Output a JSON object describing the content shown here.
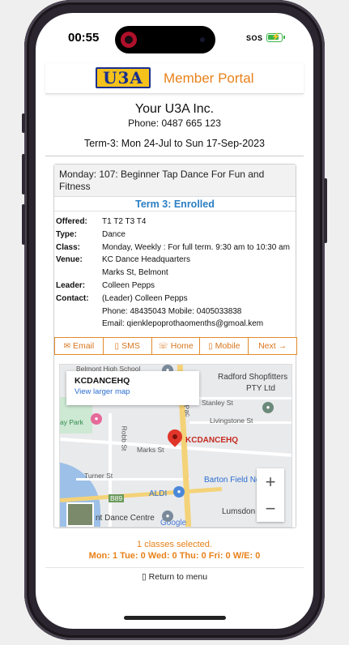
{
  "status": {
    "time": "00:55",
    "sos": "SOS"
  },
  "header": {
    "logo_text": "U3A",
    "portal_title": "Member Portal"
  },
  "org": {
    "name": "Your U3A Inc.",
    "phone": "Phone: 0487 665 123",
    "term": "Term-3: Mon 24-Jul to Sun 17-Sep-2023"
  },
  "course": {
    "title": "Monday: 107: Beginner Tap Dance For Fun and Fitness",
    "status": "Term 3: Enrolled",
    "details": [
      {
        "label": "Offered:",
        "value": "T1 T2 T3 T4"
      },
      {
        "label": "Type:",
        "value": "Dance"
      },
      {
        "label": "Class:",
        "value": "Monday, Weekly : For full term. 9:30 am to 10:30 am"
      },
      {
        "label": "Venue:",
        "value": "KC Dance Headquarters"
      },
      {
        "label": "",
        "value": "Marks St, Belmont"
      },
      {
        "label": "Leader:",
        "value": "Colleen Pepps"
      },
      {
        "label": "Contact:",
        "value": "(Leader) Colleen Pepps"
      },
      {
        "label": "",
        "value": "Phone: 48435043 Mobile: 0405033838"
      },
      {
        "label": "",
        "value": "Email: qienklepoprothaomenths@gmoal.kem"
      }
    ],
    "actions": [
      {
        "label": "Email",
        "icon": "envelope-icon",
        "glyph": "✉"
      },
      {
        "label": "SMS",
        "icon": "phone-device-icon",
        "glyph": "▯"
      },
      {
        "label": "Home",
        "icon": "telephone-icon",
        "glyph": "☏"
      },
      {
        "label": "Mobile",
        "icon": "phone-device-icon",
        "glyph": "▯"
      },
      {
        "label": "Next →",
        "icon": "",
        "glyph": ""
      }
    ]
  },
  "map": {
    "place_name": "KCDANCEHQ",
    "view_larger": "View larger map",
    "pin_label": "KCDANCEHQ",
    "labels": {
      "belmont_high": "Belmont High School",
      "radford": "Radford Shopfitters",
      "radford2": "PTY Ltd",
      "stanley": "Stanley St",
      "livingstone": "Livingstone St",
      "park": "ay Park",
      "robb": "Robb St",
      "marks": "Marks St",
      "turner": "Turner St",
      "barton": "Barton Field No",
      "aldi": "ALDI",
      "lumsdon": "Lumsdon",
      "dance_centre": "nt Dance Centre",
      "b89": "B89",
      "google": "Google",
      "pac": "Pac"
    },
    "zoom_in": "+",
    "zoom_out": "−"
  },
  "footer": {
    "selected": "1 classes selected.",
    "day_counts": "Mon: 1 Tue: 0 Wed: 0 Thu: 0 Fri: 0 W/E: 0",
    "return": "Return to menu"
  }
}
